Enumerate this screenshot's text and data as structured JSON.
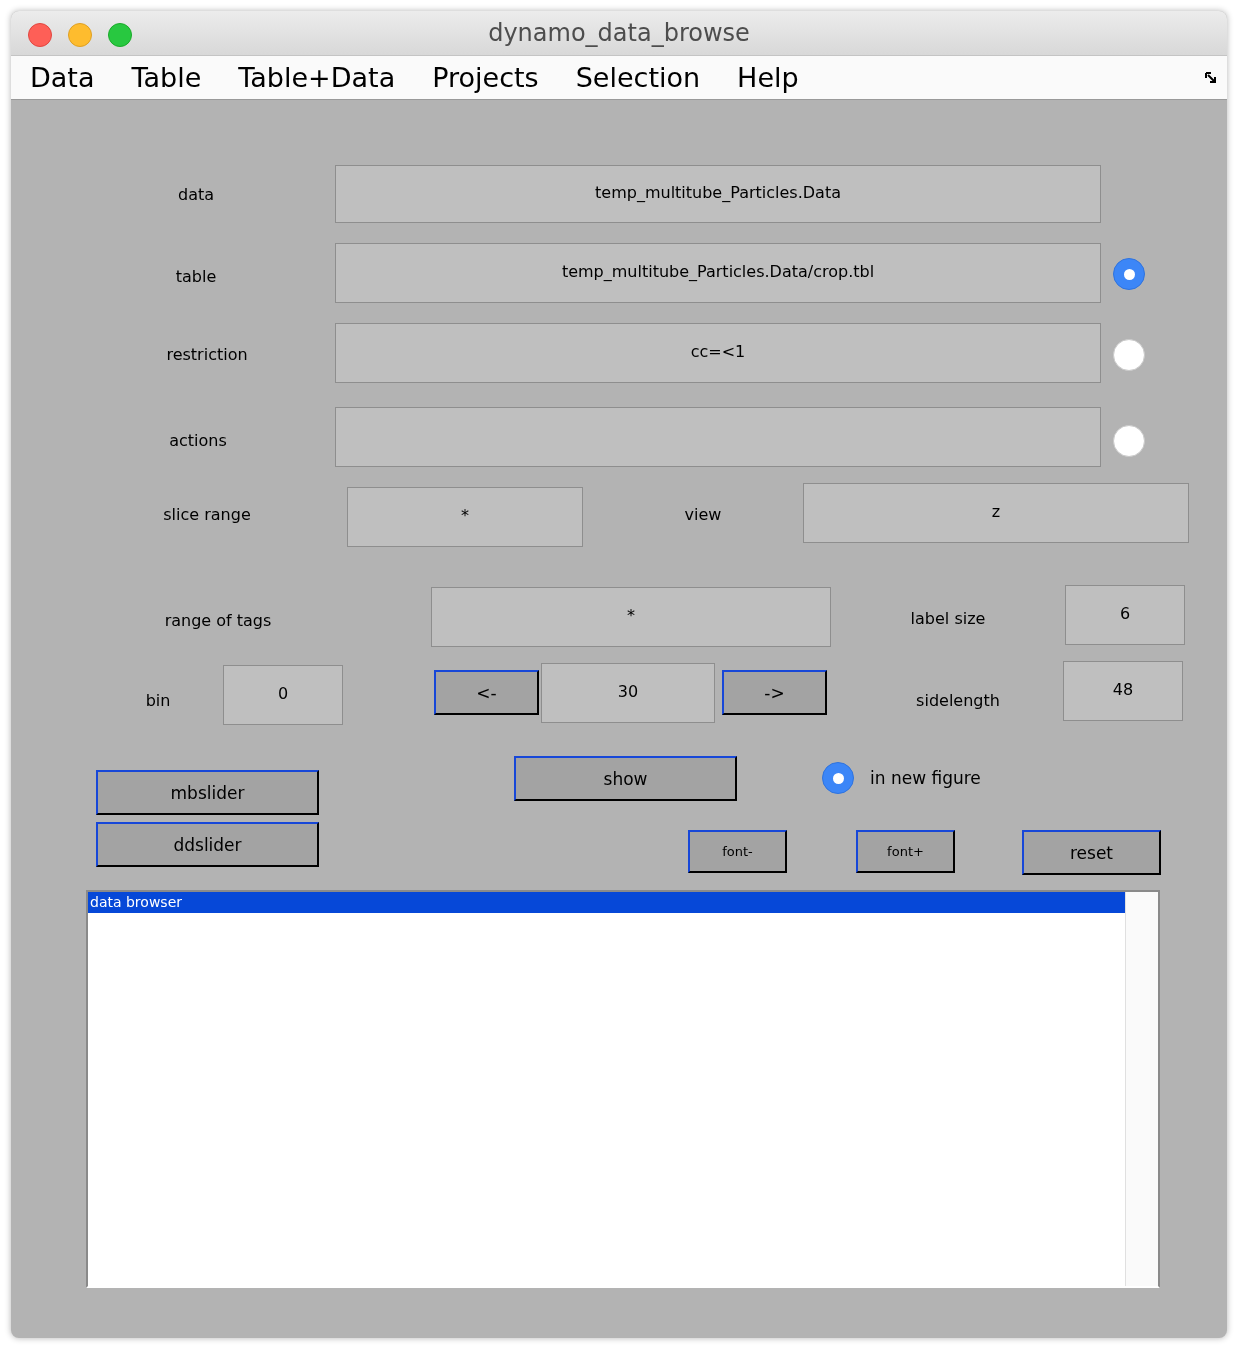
{
  "window": {
    "title": "dynamo_data_browse"
  },
  "menu": [
    "Data",
    "Table",
    "Table+Data",
    "Projects",
    "Selection",
    "Help"
  ],
  "controls": [
    {
      "kind": "label",
      "text": "data"
    },
    {
      "kind": "field",
      "value": "temp_multitube_Particles.Data"
    },
    {
      "kind": "label",
      "text": "table"
    },
    {
      "kind": "field",
      "value": "temp_multitube_Particles.Data/crop.tbl"
    },
    {
      "kind": "radio",
      "selected": true
    },
    {
      "kind": "label",
      "text": "restriction"
    },
    {
      "kind": "field",
      "value": "cc=<1"
    },
    {
      "kind": "radio",
      "selected": false
    },
    {
      "kind": "label",
      "text": "actions"
    },
    {
      "kind": "field"
    },
    {
      "kind": "radio",
      "selected": false
    },
    {
      "kind": "label",
      "text": "slice range"
    },
    {
      "kind": "field",
      "value": "*"
    },
    {
      "kind": "label",
      "text": "view"
    },
    {
      "kind": "field",
      "value": "z"
    },
    {
      "kind": "label",
      "text": "range of tags"
    },
    {
      "kind": "field",
      "value": "*"
    },
    {
      "kind": "label",
      "text": "label size"
    },
    {
      "kind": "field",
      "value": "6"
    },
    {
      "kind": "label",
      "text": "bin"
    },
    {
      "kind": "field",
      "value": "0"
    },
    {
      "kind": "button",
      "text": "<-"
    },
    {
      "kind": "field",
      "value": "30"
    },
    {
      "kind": "button",
      "text": "->"
    },
    {
      "kind": "label",
      "text": "sidelength"
    },
    {
      "kind": "field",
      "value": "48"
    },
    {
      "kind": "button",
      "text": "mbslider"
    },
    {
      "kind": "button",
      "text": "ddslider"
    },
    {
      "kind": "button",
      "text": "show"
    },
    {
      "kind": "radio",
      "selected": true,
      "text": "in new figure"
    },
    {
      "kind": "button",
      "text": "font-",
      "small": true
    },
    {
      "kind": "button",
      "text": "font+",
      "small": true
    },
    {
      "kind": "button",
      "text": "reset"
    }
  ],
  "listbox": {
    "items": [
      {
        "text": "data browser",
        "selected": true
      }
    ]
  }
}
